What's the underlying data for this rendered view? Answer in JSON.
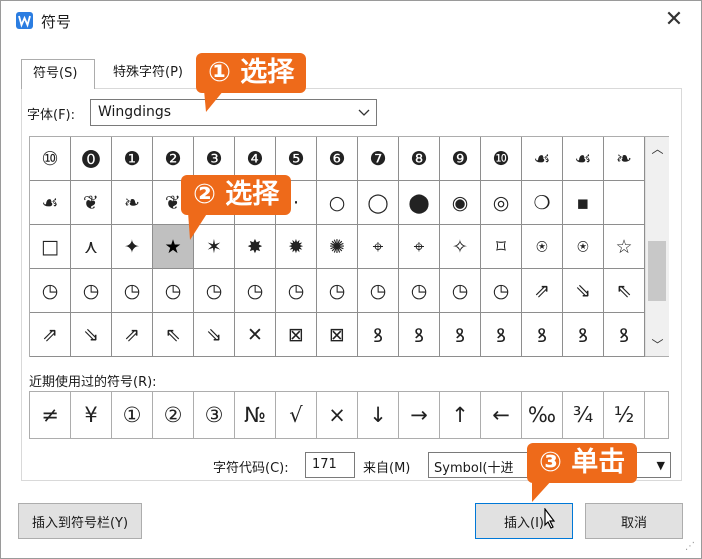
{
  "window": {
    "title": "符号",
    "close": "✕"
  },
  "tabs": [
    {
      "label": "符号(S)",
      "active": true
    },
    {
      "label": "特殊字符(P)",
      "active": false
    }
  ],
  "font": {
    "label": "字体(F):",
    "value": "Wingdings"
  },
  "symbols": [
    "⑩",
    "⓿",
    "❶",
    "❷",
    "❸",
    "❹",
    "❺",
    "❻",
    "❼",
    "❽",
    "❾",
    "❿",
    "☙",
    "☙",
    "❧",
    "☙",
    "❦",
    "❧",
    "❦",
    "✿",
    "·",
    "·",
    "○",
    "◯",
    "⬤",
    "◉",
    "◎",
    "❍",
    "▪",
    "",
    "□",
    "⋏",
    "✦",
    "★",
    "✶",
    "✸",
    "✹",
    "✺",
    "⌖",
    "⌖",
    "✧",
    "⌑",
    "⍟",
    "⍟",
    "☆",
    "◷",
    "◷",
    "◷",
    "◷",
    "◷",
    "◷",
    "◷",
    "◷",
    "◷",
    "◷",
    "◷",
    "◷",
    "⇗",
    "⇘",
    "⇖",
    "⇗",
    "⇘",
    "⇗",
    "⇖",
    "⇘",
    "✕",
    "⊠",
    "⊠",
    "ꝸ",
    "ꝸ",
    "ꝸ",
    "ꝸ",
    "ꝸ",
    "ꝸ",
    "ꝸ"
  ],
  "selected_index": 33,
  "recent": {
    "label": "近期使用过的符号(R):",
    "items": [
      "≠",
      "¥",
      "①",
      "②",
      "③",
      "№",
      "√",
      "×",
      "↓",
      "→",
      "↑",
      "←",
      "‰",
      "¾",
      "½"
    ]
  },
  "char_code": {
    "label": "字符代码(C):",
    "value": "171"
  },
  "from": {
    "label": "来自(M)",
    "value": "Symbol(十进"
  },
  "buttons": {
    "insert_to_toolbar": "插入到符号栏(Y)",
    "insert": "插入(I)",
    "cancel": "取消"
  },
  "callouts": [
    "① 选择",
    "② 选择",
    "③ 单击"
  ],
  "colors": {
    "callout": "#ee6a1a",
    "app_icon": "#2b7de1"
  }
}
